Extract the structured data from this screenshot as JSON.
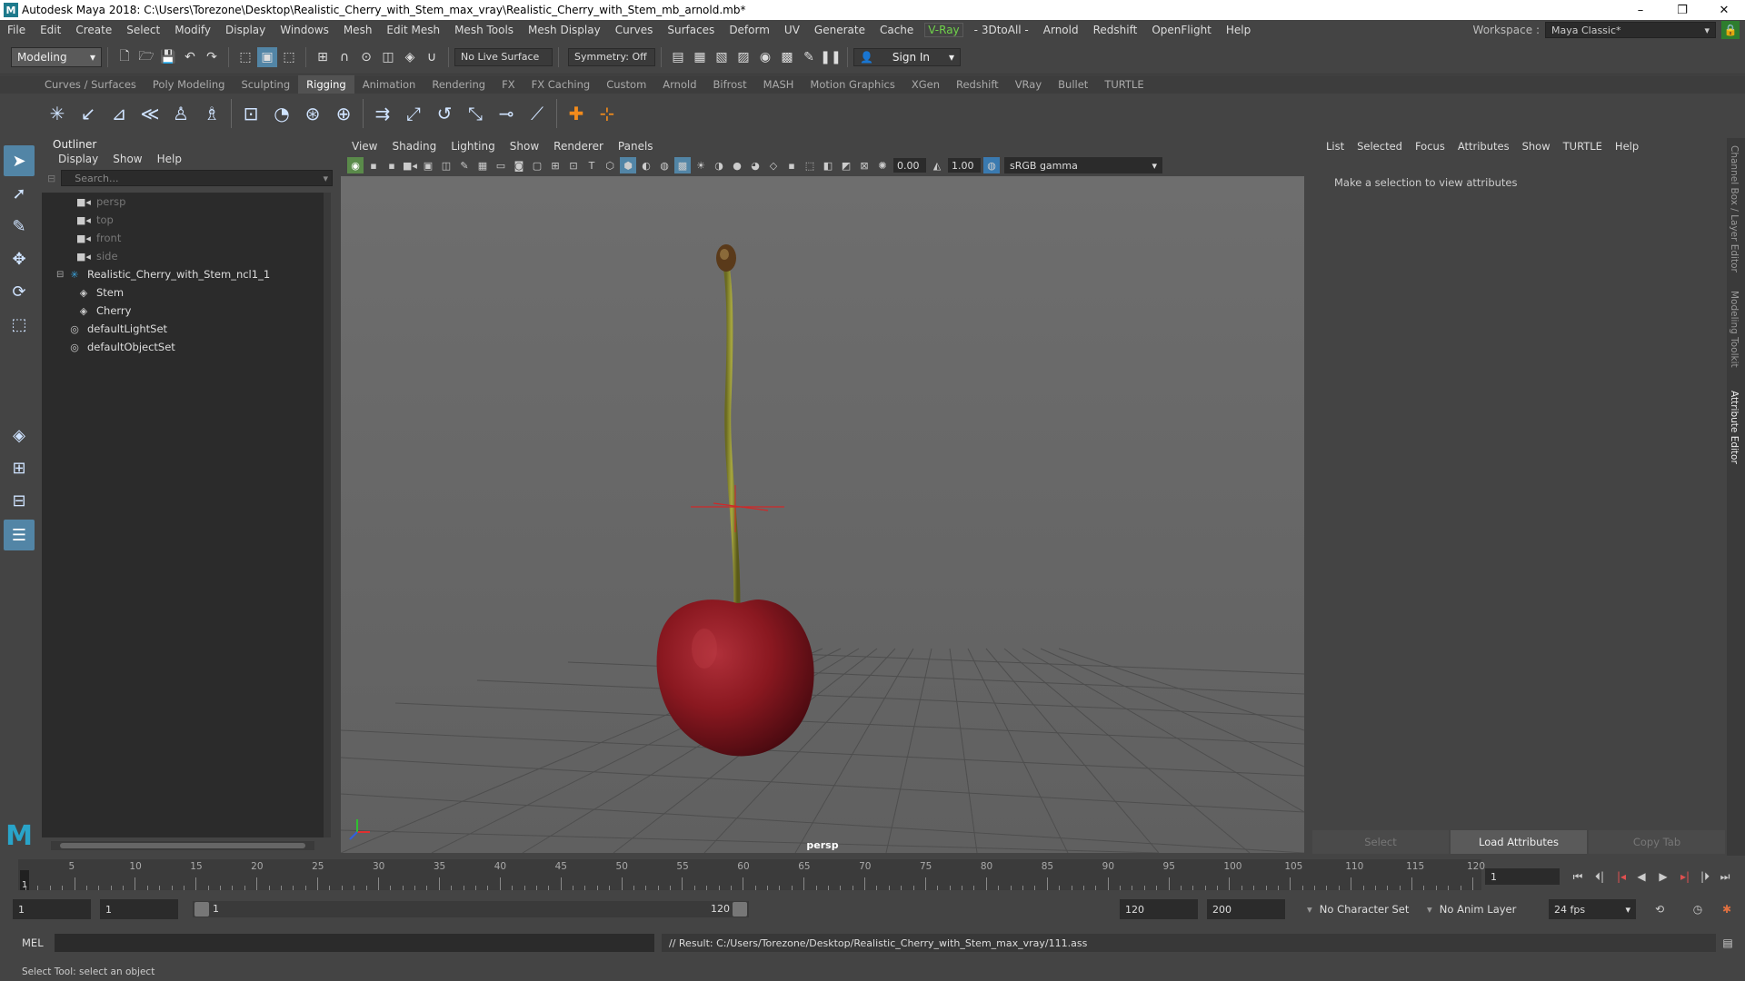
{
  "window": {
    "title": "Autodesk Maya 2018: C:\\Users\\Torezone\\Desktop\\Realistic_Cherry_with_Stem_max_vray\\Realistic_Cherry_with_Stem_mb_arnold.mb*",
    "minimize": "–",
    "maximize": "❐",
    "close": "✕",
    "logo": "M"
  },
  "menubar": {
    "items": [
      "File",
      "Edit",
      "Create",
      "Select",
      "Modify",
      "Display",
      "Windows",
      "Mesh",
      "Edit Mesh",
      "Mesh Tools",
      "Mesh Display",
      "Curves",
      "Surfaces",
      "Deform",
      "UV",
      "Generate",
      "Cache"
    ],
    "vray": "V-Ray",
    "items2": [
      "- 3DtoAll -",
      "Arnold",
      "Redshift",
      "OpenFlight",
      "Help"
    ],
    "workspace_label": "Workspace :",
    "workspace_value": "Maya Classic*"
  },
  "statusline": {
    "mode": "Modeling",
    "live_surface": "No Live Surface",
    "symmetry": "Symmetry: Off",
    "sign_in": "Sign In"
  },
  "shelf": {
    "tabs": [
      "Curves / Surfaces",
      "Poly Modeling",
      "Sculpting",
      "Rigging",
      "Animation",
      "Rendering",
      "FX",
      "FX Caching",
      "Custom",
      "Arnold",
      "Bifrost",
      "MASH",
      "Motion Graphics",
      "XGen",
      "Redshift",
      "VRay",
      "Bullet",
      "TURTLE"
    ],
    "active_tab": "Rigging"
  },
  "outliner": {
    "title": "Outliner",
    "menu": [
      "Display",
      "Show",
      "Help"
    ],
    "search_placeholder": "Search...",
    "cameras": [
      "persp",
      "top",
      "front",
      "side"
    ],
    "group": "Realistic_Cherry_with_Stem_ncl1_1",
    "children": [
      "Stem",
      "Cherry"
    ],
    "sets": [
      "defaultLightSet",
      "defaultObjectSet"
    ]
  },
  "viewport": {
    "menu": [
      "View",
      "Shading",
      "Lighting",
      "Show",
      "Renderer",
      "Panels"
    ],
    "exposure": "0.00",
    "gamma": "1.00",
    "color_space": "sRGB gamma",
    "camera_label": "persp"
  },
  "attribute_editor": {
    "menu": [
      "List",
      "Selected",
      "Focus",
      "Attributes",
      "Show",
      "TURTLE",
      "Help"
    ],
    "message": "Make a selection to view attributes",
    "buttons": [
      "Select",
      "Load Attributes",
      "Copy Tab"
    ]
  },
  "side_tabs": [
    "Channel Box / Layer Editor",
    "Modeling Toolkit",
    "Attribute Editor"
  ],
  "timeline": {
    "labels": [
      "5",
      "10",
      "15",
      "20",
      "25",
      "30",
      "35",
      "40",
      "45",
      "50",
      "55",
      "60",
      "65",
      "70",
      "75",
      "80",
      "85",
      "90",
      "95",
      "100",
      "105",
      "110",
      "115",
      "120"
    ],
    "cursor_frame": "1",
    "current_frame": "1"
  },
  "range": {
    "start": "1",
    "playback_start": "1",
    "slider_start": "1",
    "slider_end": "120",
    "playback_end": "120",
    "end": "200",
    "character_set": "No Character Set",
    "anim_layer": "No Anim Layer",
    "fps": "24 fps"
  },
  "command_line": {
    "language": "MEL",
    "result": "// Result: C:/Users/Torezone/Desktop/Realistic_Cherry_with_Stem_max_vray/111.ass"
  },
  "help_line": "Select Tool: select an object",
  "colors": {
    "active_tool": "#5285a6",
    "cherry": "#8e1a22",
    "stem": "#8a8a2a",
    "vray": "#6fd24a"
  }
}
